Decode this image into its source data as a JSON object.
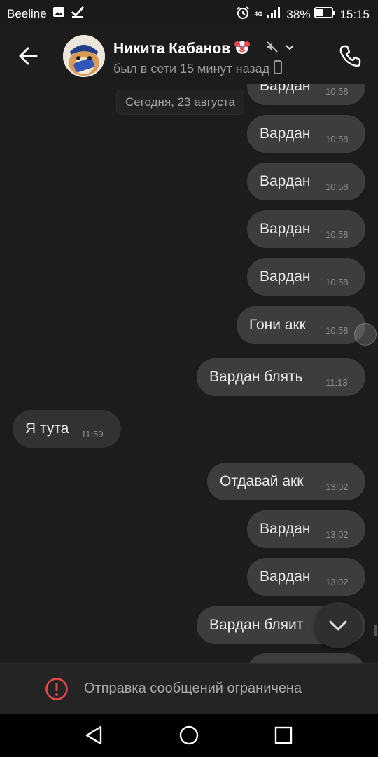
{
  "status_bar": {
    "carrier": "Beeline",
    "network": "4G",
    "battery": "38%",
    "time": "15:15"
  },
  "header": {
    "contact_name": "Никита Кабанов",
    "last_seen": "был в сети 15 минут назад"
  },
  "chat": {
    "date_separator": "Сегодня, 23 августа",
    "messages": [
      {
        "text": "Вардан",
        "time": "10:58",
        "dir": "out"
      },
      {
        "text": "Вардан",
        "time": "10:58",
        "dir": "out"
      },
      {
        "text": "Вардан",
        "time": "10:58",
        "dir": "out"
      },
      {
        "text": "Вардан",
        "time": "10:58",
        "dir": "out"
      },
      {
        "text": "Вардан",
        "time": "10:58",
        "dir": "out"
      },
      {
        "text": "Гони акк",
        "time": "10:58",
        "dir": "out"
      },
      {
        "text": "Вардан блять",
        "time": "11:13",
        "dir": "out"
      },
      {
        "text": "Я тута",
        "time": "11:59",
        "dir": "in"
      },
      {
        "text": "Отдавай акк",
        "time": "13:02",
        "dir": "out"
      },
      {
        "text": "Вардан",
        "time": "13:02",
        "dir": "out"
      },
      {
        "text": "Вардан",
        "time": "13:02",
        "dir": "out"
      },
      {
        "text": "Вардан бляит",
        "time": "",
        "dir": "out"
      }
    ]
  },
  "composer": {
    "restricted_text": "Отправка сообщений ограничена"
  },
  "colors": {
    "background": "#1c1c1c",
    "bubble_out": "#3d3d3d",
    "bubble_in": "#323232",
    "alert_red": "#e8484c"
  }
}
